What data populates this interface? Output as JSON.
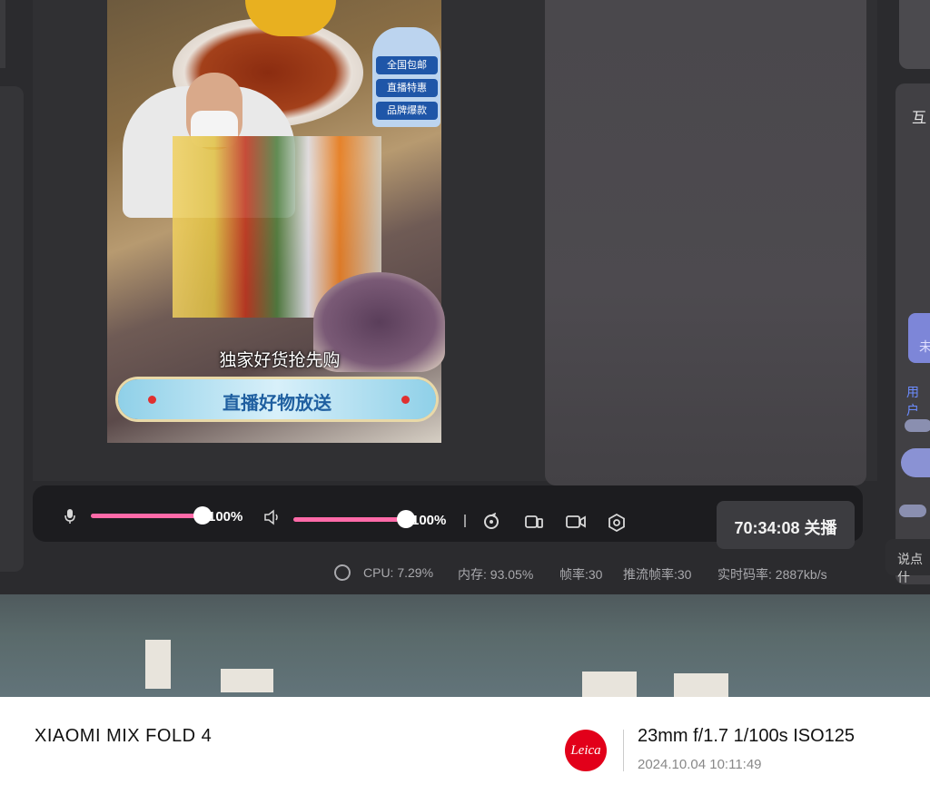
{
  "preview": {
    "sign_items": [
      "全国包邮",
      "直播特惠",
      "品牌爆款"
    ],
    "caption": "独家好货抢先购",
    "banner": "直播好物放送"
  },
  "side_panel": {
    "title": "互",
    "card_text": "未",
    "user_label": "用户",
    "input_placeholder": "说点什"
  },
  "toolbar": {
    "mic_volume_label": "100%",
    "mic_volume_level": 1.0,
    "speaker_volume_label": "100%",
    "speaker_volume_level": 1.0,
    "icons": [
      "microphone-icon",
      "speaker-icon",
      "refresh-icon",
      "screen-cast-icon",
      "camera-icon",
      "settings-icon"
    ],
    "timer": "70:34:08",
    "end_stream_label": "关播",
    "accent_color": "#ff6aa8"
  },
  "stats": {
    "cpu": "CPU: 7.29%",
    "memory": "内存: 93.05%",
    "frame_rate": "帧率:30",
    "push_frame_rate": "推流帧率:30",
    "bitrate": "实时码率: 2887kb/s"
  },
  "photo_caption": {
    "device": "XIAOMI MIX FOLD 4",
    "brand": "Leica",
    "brand_color": "#e2001a",
    "params": "23mm  f/1.7  1/100s  ISO125",
    "datetime": "2024.10.04 10:11:49"
  }
}
